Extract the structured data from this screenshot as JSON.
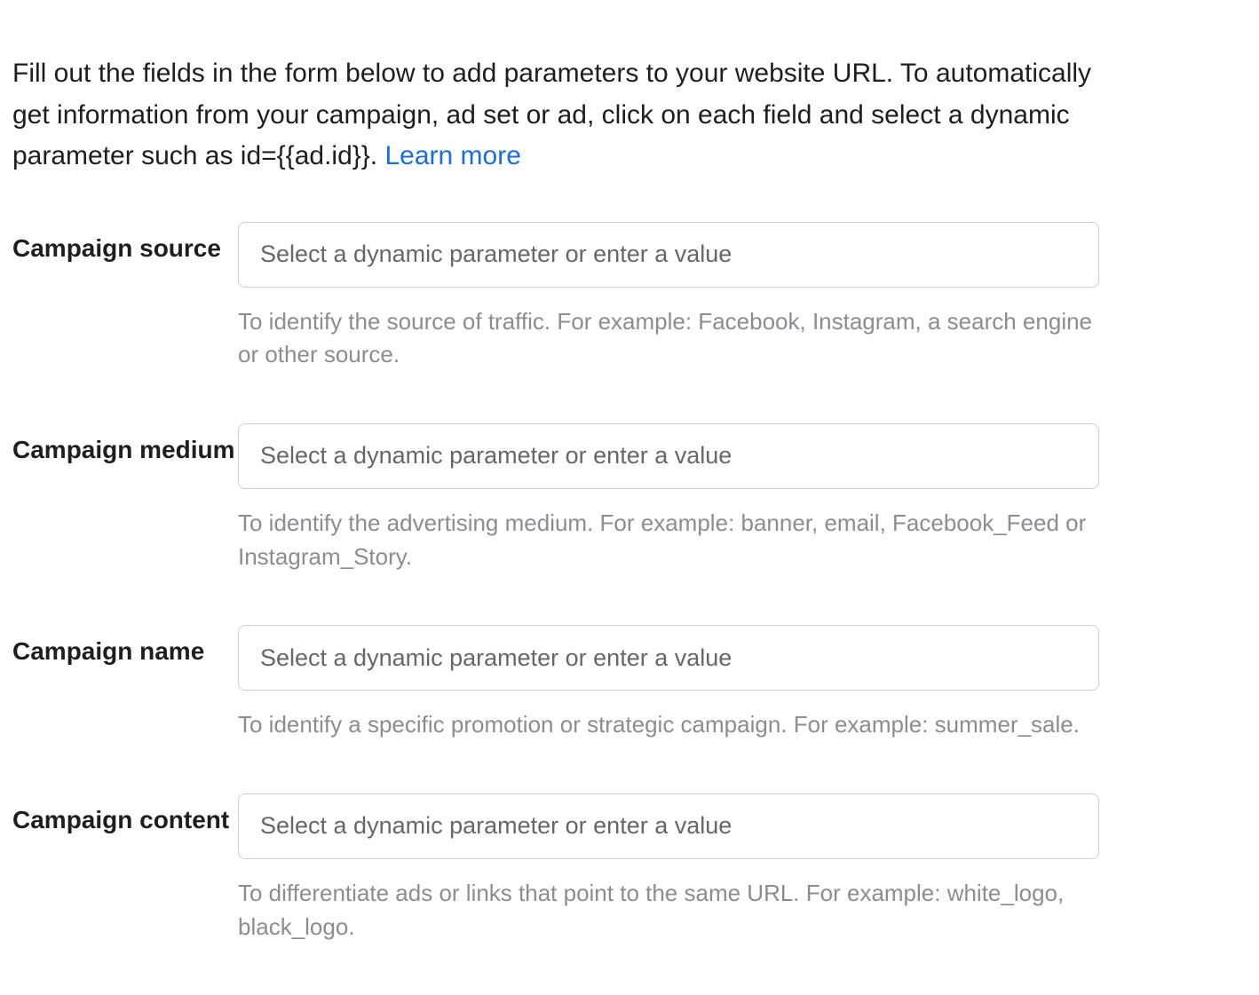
{
  "intro": {
    "text": "Fill out the fields in the form below to add parameters to your website URL. To automatically get information from your campaign, ad set or ad, click on each field and select a dynamic parameter such as id={{ad.id}}. ",
    "link_label": "Learn more"
  },
  "fields": {
    "source": {
      "label": "Campaign source",
      "placeholder": "Select a dynamic parameter or enter a value",
      "help": "To identify the source of traffic. For example: Facebook, Instagram, a search engine or other source."
    },
    "medium": {
      "label": "Campaign medium",
      "placeholder": "Select a dynamic parameter or enter a value",
      "help": "To identify the advertising medium. For example: banner, email, Facebook_Feed or Instagram_Story."
    },
    "name": {
      "label": "Campaign name",
      "placeholder": "Select a dynamic parameter or enter a value",
      "help": "To identify a specific promotion or strategic campaign. For example: summer_sale."
    },
    "content": {
      "label": "Campaign content",
      "placeholder": "Select a dynamic parameter or enter a value",
      "help": "To differentiate ads or links that point to the same URL. For example: white_logo, black_logo."
    }
  }
}
